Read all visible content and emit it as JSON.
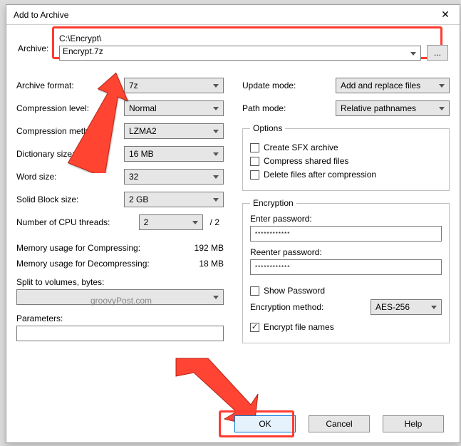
{
  "title": "Add to Archive",
  "archive": {
    "label": "Archive:",
    "path": "C:\\Encrypt\\",
    "filename": "Encrypt.7z",
    "browse": "..."
  },
  "left": {
    "format_label": "Archive format:",
    "format_value": "7z",
    "level_label": "Compression level:",
    "level_value": "Normal",
    "method_label": "Compression method:",
    "method_value": "LZMA2",
    "dict_label": "Dictionary size:",
    "dict_value": "16 MB",
    "word_label": "Word size:",
    "word_value": "32",
    "solid_label": "Solid Block size:",
    "solid_value": "2 GB",
    "threads_label": "Number of CPU threads:",
    "threads_value": "2",
    "threads_total": "/ 2",
    "mem_comp_label": "Memory usage for Compressing:",
    "mem_comp_value": "192 MB",
    "mem_decomp_label": "Memory usage for Decompressing:",
    "mem_decomp_value": "18 MB",
    "split_label": "Split to volumes, bytes:",
    "split_value": "",
    "params_label": "Parameters:",
    "params_value": ""
  },
  "right": {
    "update_label": "Update mode:",
    "update_value": "Add and replace files",
    "path_label": "Path mode:",
    "path_value": "Relative pathnames",
    "options_legend": "Options",
    "opt_sfx": "Create SFX archive",
    "opt_shared": "Compress shared files",
    "opt_delete": "Delete files after compression",
    "enc_legend": "Encryption",
    "enter_pw_label": "Enter password:",
    "enter_pw_value": "************",
    "reenter_pw_label": "Reenter password:",
    "reenter_pw_value": "************",
    "show_pw": "Show Password",
    "enc_method_label": "Encryption method:",
    "enc_method_value": "AES-256",
    "encrypt_names": "Encrypt file names"
  },
  "buttons": {
    "ok": "OK",
    "cancel": "Cancel",
    "help": "Help"
  },
  "watermark": "groovyPost.com"
}
